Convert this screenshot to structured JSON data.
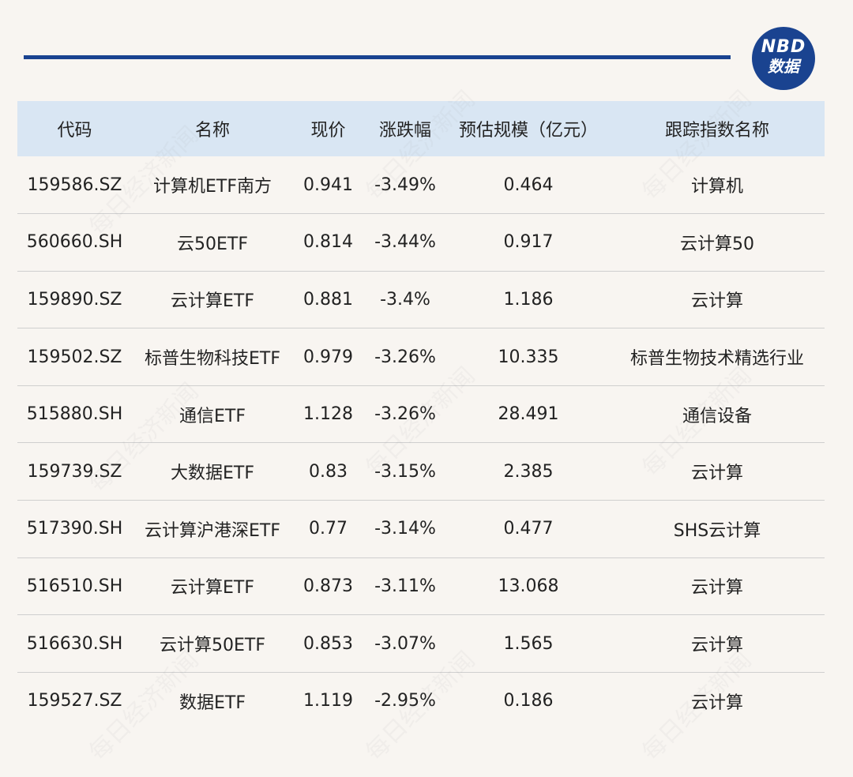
{
  "logo": {
    "line1": "NBD",
    "line2": "数据"
  },
  "watermark_text": "每日经济新闻",
  "table": {
    "headers": [
      "代码",
      "名称",
      "现价",
      "涨跌幅",
      "预估规模（亿元）",
      "跟踪指数名称"
    ],
    "rows": [
      [
        "159586.SZ",
        "计算机ETF南方",
        "0.941",
        "-3.49%",
        "0.464",
        "计算机"
      ],
      [
        "560660.SH",
        "云50ETF",
        "0.814",
        "-3.44%",
        "0.917",
        "云计算50"
      ],
      [
        "159890.SZ",
        "云计算ETF",
        "0.881",
        "-3.4%",
        "1.186",
        "云计算"
      ],
      [
        "159502.SZ",
        "标普生物科技ETF",
        "0.979",
        "-3.26%",
        "10.335",
        "标普生物技术精选行业"
      ],
      [
        "515880.SH",
        "通信ETF",
        "1.128",
        "-3.26%",
        "28.491",
        "通信设备"
      ],
      [
        "159739.SZ",
        "大数据ETF",
        "0.83",
        "-3.15%",
        "2.385",
        "云计算"
      ],
      [
        "517390.SH",
        "云计算沪港深ETF",
        "0.77",
        "-3.14%",
        "0.477",
        "SHS云计算"
      ],
      [
        "516510.SH",
        "云计算ETF",
        "0.873",
        "-3.11%",
        "13.068",
        "云计算"
      ],
      [
        "516630.SH",
        "云计算50ETF",
        "0.853",
        "-3.07%",
        "1.565",
        "云计算"
      ],
      [
        "159527.SZ",
        "数据ETF",
        "1.119",
        "-2.95%",
        "0.186",
        "云计算"
      ]
    ]
  }
}
